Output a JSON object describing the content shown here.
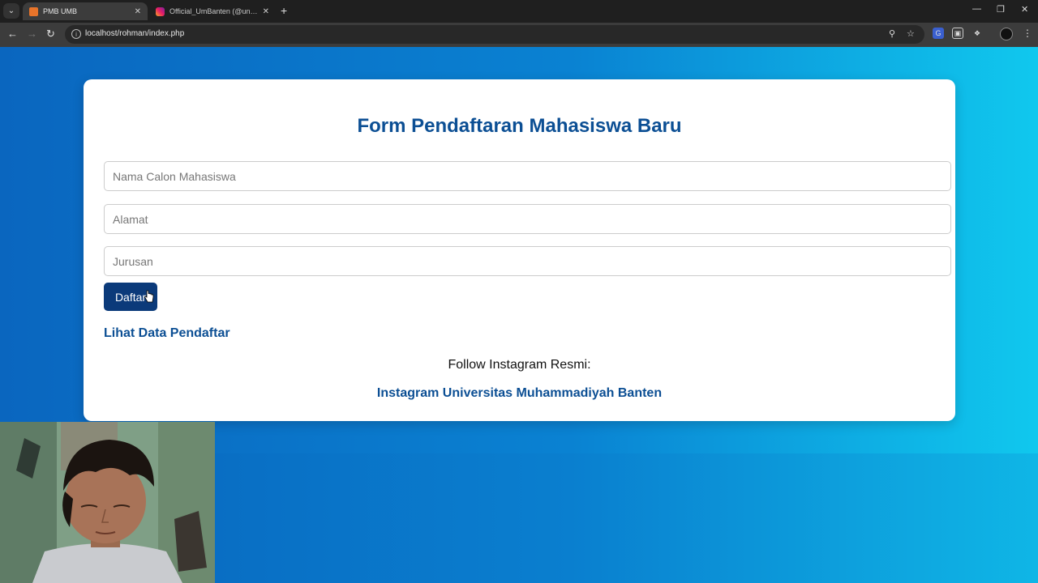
{
  "browser": {
    "tabs": [
      {
        "title": "PMB UMB",
        "active": true
      },
      {
        "title": "Official_UmBanten (@univ_muh...",
        "active": false
      }
    ],
    "url": "localhost/rohman/index.php"
  },
  "form": {
    "title": "Form Pendaftaran Mahasiswa Baru",
    "fields": [
      {
        "placeholder": "Nama Calon Mahasiswa",
        "value": ""
      },
      {
        "placeholder": "Alamat",
        "value": ""
      },
      {
        "placeholder": "Jurusan",
        "value": ""
      }
    ],
    "submit_label": "Daftar"
  },
  "links": {
    "data_pendaftar": "Lihat Data Pendaftar",
    "follow_text": "Follow Instagram Resmi:",
    "instagram": "Instagram Universitas Muhammadiyah Banten"
  },
  "colors": {
    "title": "#0c4f94",
    "button": "#0b3a7a",
    "background_start": "#0a66bf",
    "background_end": "#10c8ee"
  }
}
